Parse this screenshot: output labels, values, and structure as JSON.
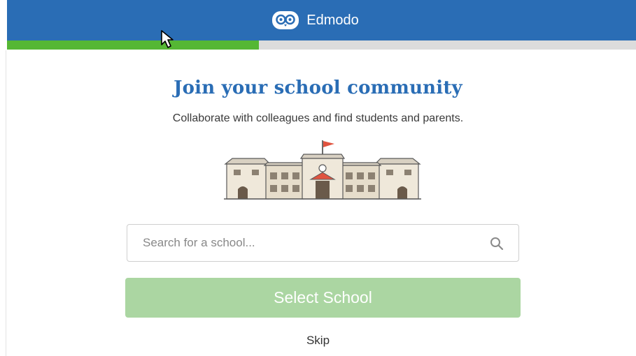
{
  "header": {
    "app_name": "Edmodo",
    "logo_icon": "edmodo-owl-logo",
    "background_color": "#2a6db5"
  },
  "progress": {
    "fraction": 0.4,
    "fill_color": "#55b734",
    "track_color": "#dcdcdc"
  },
  "main": {
    "title": "Join your school community",
    "subtitle": "Collaborate with colleagues and find students and parents.",
    "illustration_icon": "school-building-icon"
  },
  "search": {
    "placeholder": "Search for a school...",
    "value": "",
    "icon": "search-icon"
  },
  "actions": {
    "select_label": "Select School",
    "skip_label": "Skip",
    "select_color": "#abd6a2"
  }
}
